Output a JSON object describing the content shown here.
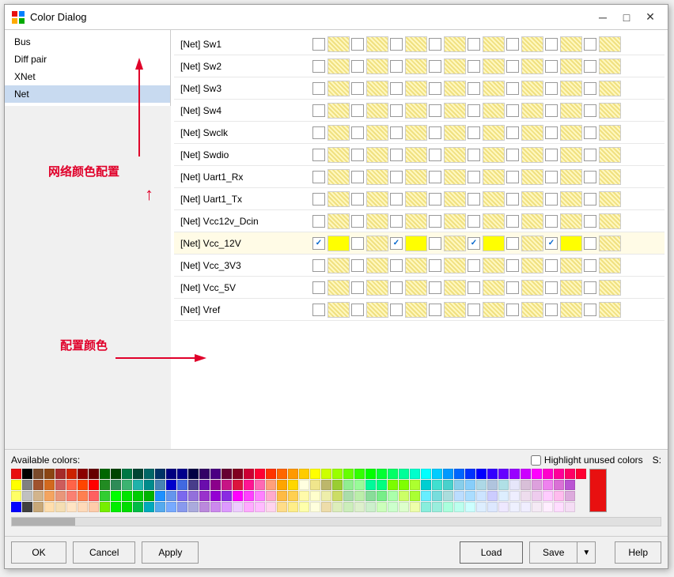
{
  "window": {
    "title": "Color Dialog",
    "minimize_label": "─",
    "maximize_label": "□",
    "close_label": "✕"
  },
  "left_panel": {
    "items": [
      {
        "label": "Bus",
        "selected": false
      },
      {
        "label": "Diff pair",
        "selected": false
      },
      {
        "label": "XNet",
        "selected": false
      },
      {
        "label": "Net",
        "selected": true
      }
    ]
  },
  "annotations": {
    "network_config": "网络颜色配置",
    "config_color": "配置颜色"
  },
  "grid": {
    "rows": [
      {
        "label": "[Net] Sw1",
        "highlighted": false,
        "checked_cells": []
      },
      {
        "label": "[Net] Sw2",
        "highlighted": false,
        "checked_cells": []
      },
      {
        "label": "[Net] Sw3",
        "highlighted": false,
        "checked_cells": []
      },
      {
        "label": "[Net] Sw4",
        "highlighted": false,
        "checked_cells": []
      },
      {
        "label": "[Net] Swclk",
        "highlighted": false,
        "checked_cells": []
      },
      {
        "label": "[Net] Swdio",
        "highlighted": false,
        "checked_cells": []
      },
      {
        "label": "[Net] Uart1_Rx",
        "highlighted": false,
        "checked_cells": []
      },
      {
        "label": "[Net] Uart1_Tx",
        "highlighted": false,
        "checked_cells": []
      },
      {
        "label": "[Net] Vcc12v_Dcin",
        "highlighted": false,
        "checked_cells": []
      },
      {
        "label": "[Net] Vcc_12V",
        "highlighted": true,
        "checked_cells": [
          0,
          2,
          4,
          6,
          8
        ]
      },
      {
        "label": "[Net] Vcc_3V3",
        "highlighted": false,
        "checked_cells": []
      },
      {
        "label": "[Net] Vcc_5V",
        "highlighted": false,
        "checked_cells": []
      },
      {
        "label": "[Net] Vref",
        "highlighted": false,
        "checked_cells": []
      }
    ],
    "columns_count": 8
  },
  "bottom": {
    "available_colors_label": "Available colors:",
    "highlight_label": "Highlight unused colors",
    "s_label": "S:",
    "selected_color": "#e81010"
  },
  "buttons": {
    "ok": "OK",
    "cancel": "Cancel",
    "apply": "Apply",
    "load": "Load",
    "save": "Save",
    "help": "Help"
  },
  "palette": {
    "rows": [
      [
        "#e81010",
        "#000000",
        "#7a4a2a",
        "#8b4513",
        "#a52a2a",
        "#cc2200",
        "#8b0000",
        "#660000",
        "#006600",
        "#004400",
        "#007744",
        "#004433",
        "#006666",
        "#003366",
        "#000080",
        "#00008b",
        "#000044",
        "#330066",
        "#4b0082",
        "#660033",
        "#800020",
        "#cc0033",
        "#ff0033",
        "#ff3300",
        "#ff6600",
        "#ff9900",
        "#ffcc00",
        "#ffff00",
        "#ccff00",
        "#99ff00",
        "#66ff00",
        "#33ff00",
        "#00ff00",
        "#00ff33",
        "#00ff66",
        "#00ff99",
        "#00ffcc",
        "#00ffff",
        "#00ccff",
        "#0099ff",
        "#0066ff",
        "#0033ff",
        "#0000ff",
        "#3300ff",
        "#6600ff",
        "#9900ff",
        "#cc00ff",
        "#ff00ff",
        "#ff00cc",
        "#ff0099",
        "#ff0066",
        "#ff0033"
      ],
      [
        "#ffff00",
        "#808080",
        "#a0522d",
        "#d2691e",
        "#cd5c5c",
        "#ff6347",
        "#ff4500",
        "#ff0000",
        "#228b22",
        "#2e8b57",
        "#3cb371",
        "#20b2aa",
        "#008b8b",
        "#4682b4",
        "#0000cd",
        "#4169e1",
        "#483d8b",
        "#6a0dad",
        "#8b008b",
        "#c71585",
        "#dc143c",
        "#ff1493",
        "#ff69b4",
        "#ffa07a",
        "#ffa500",
        "#ffd700",
        "#ffffe0",
        "#f0e68c",
        "#bdb76b",
        "#9acd32",
        "#90ee90",
        "#98fb98",
        "#00fa9a",
        "#00ff7f",
        "#7cfc00",
        "#7fff00",
        "#adff2f",
        "#00ced1",
        "#40e0d0",
        "#48d1cc",
        "#87ceeb",
        "#87cefa",
        "#add8e6",
        "#b0c4de",
        "#b0e0e6",
        "#e6e6fa",
        "#d8bfd8",
        "#dda0dd",
        "#ee82ee",
        "#da70d6",
        "#ba55d3"
      ],
      [
        "#ffff66",
        "#c0c0c0",
        "#d2b48c",
        "#f4a460",
        "#e9967a",
        "#fa8072",
        "#ff7f50",
        "#ff6060",
        "#32cd32",
        "#00ff00",
        "#00e400",
        "#00cc00",
        "#00b300",
        "#1e90ff",
        "#6495ed",
        "#7b68ee",
        "#9370db",
        "#9932cc",
        "#9400d3",
        "#8a2be2",
        "#ff00ff",
        "#ff40ff",
        "#ff80ff",
        "#ffaacc",
        "#ffbb44",
        "#ffd050",
        "#fffaaa",
        "#ffffcc",
        "#eeeeaa",
        "#ccdd66",
        "#aaddaa",
        "#bbeeaa",
        "#88dd99",
        "#77ee88",
        "#aaffaa",
        "#ccff66",
        "#aaff33",
        "#66eeff",
        "#77dddd",
        "#aadddd",
        "#bbddff",
        "#aaddff",
        "#cce4ff",
        "#ccccff",
        "#ddeeff",
        "#eeeeff",
        "#eeddee",
        "#eeccee",
        "#ffccff",
        "#ffbbee",
        "#ddaadd"
      ],
      [
        "#0000ff",
        "#404040",
        "#c8a878",
        "#ffdead",
        "#f5deb3",
        "#ffe4c4",
        "#ffdab9",
        "#ffccaa",
        "#76ee00",
        "#00ee00",
        "#00dd00",
        "#00bb44",
        "#00aabb",
        "#55aaee",
        "#77aaff",
        "#8899ee",
        "#aaaadd",
        "#bb88dd",
        "#cc88ee",
        "#dd99ff",
        "#eeccff",
        "#ffaaff",
        "#ffbbff",
        "#ffd4ee",
        "#ffdd88",
        "#ffee88",
        "#ffffaa",
        "#ffffdd",
        "#eeddaa",
        "#ddeebb",
        "#cceebb",
        "#ddf0cc",
        "#ccf0cc",
        "#ccffbb",
        "#ccffcc",
        "#ddffcc",
        "#eeffaa",
        "#88eedd",
        "#99eedd",
        "#aaffdd",
        "#bbffee",
        "#ccffff",
        "#ddeeff",
        "#dde8ff",
        "#eee8ff",
        "#eef0ff",
        "#f0eeff",
        "#f5eaf5",
        "#ffeeff",
        "#ffddff",
        "#f5ddf5"
      ]
    ]
  }
}
